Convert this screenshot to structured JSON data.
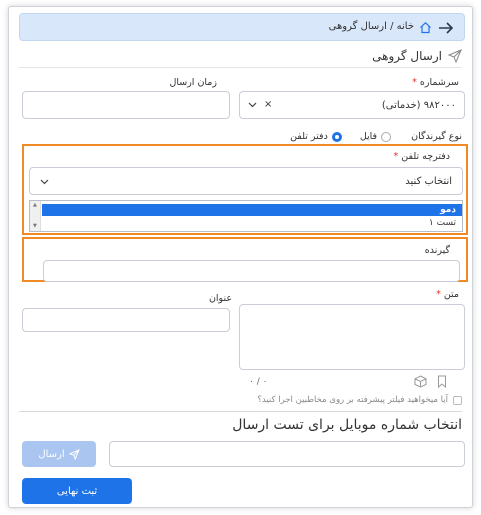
{
  "breadcrumb": {
    "home": "خانه",
    "separator": "/",
    "current": "ارسال گروهی"
  },
  "page": {
    "title": "ارسال گروهی"
  },
  "form": {
    "sender_label": "سرشماره",
    "sender_value": "۹۸۲۰۰۰ (خدماتی)",
    "sender_clear": "×",
    "send_time_label": "زمان ارسال",
    "send_time_value": "",
    "recipient_type_label": "نوع گیرندگان",
    "recipient_types": [
      {
        "label": "فایل",
        "selected": false
      },
      {
        "label": "دفتر تلفن",
        "selected": true
      }
    ],
    "phonebook_label": "دفترچه تلفن",
    "phonebook_placeholder": "انتخاب کنید",
    "phonebook_options": [
      {
        "label": "دمو",
        "highlighted": true
      },
      {
        "label": "تست ۱",
        "highlighted": false
      }
    ],
    "receiver_label": "گیرنده",
    "receiver_value": "",
    "text_label": "متن",
    "text_value": "",
    "subject_label": "عنوان",
    "subject_value": "",
    "counter": "۰ / ۰",
    "advanced_filter_hint": "آیا میخواهید فیلتر پیشرفته بر روی مخاطبین اجرا کنید؟"
  },
  "test_section": {
    "heading": "انتخاب شماره موبایل برای تست ارسال",
    "mobile_value": "",
    "send_label": "ارسال"
  },
  "submit_label": "ثبت نهایی",
  "required_mark": "*",
  "colors": {
    "primary": "#1e73e8",
    "highlight_box": "#f08a24",
    "topbar_bg": "#d9e7fa",
    "required": "#d9342b"
  }
}
